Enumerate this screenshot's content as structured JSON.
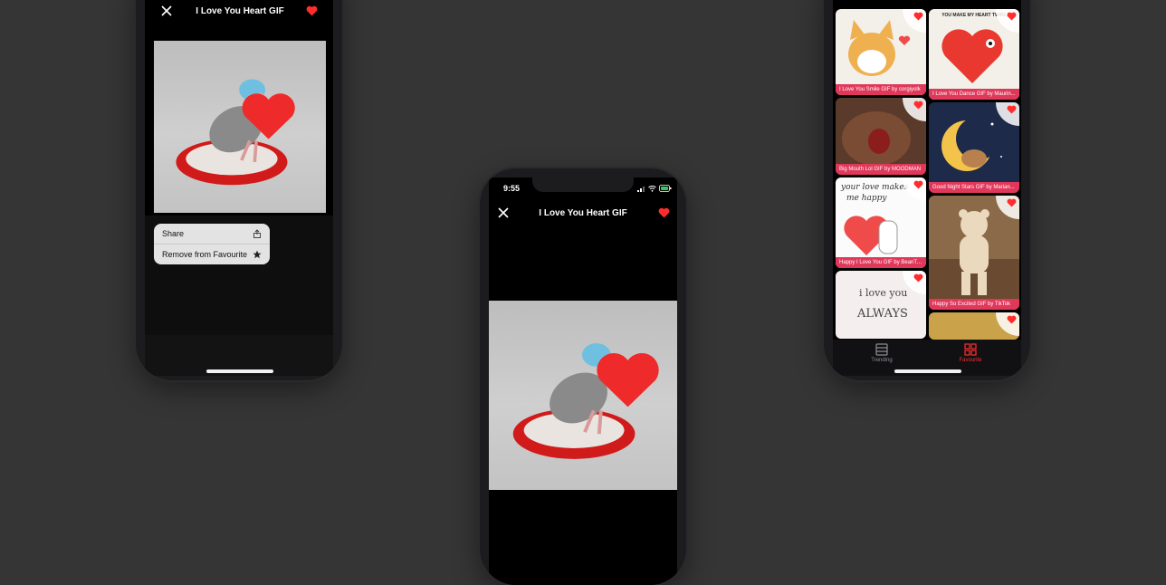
{
  "colors": {
    "accent": "#ff2d2d",
    "caption_bg": "#e0385a",
    "background": "#353535"
  },
  "left_phone": {
    "title": "I Love You Heart GIF",
    "menu": [
      {
        "label": "Share",
        "icon": "share-icon"
      },
      {
        "label": "Remove from Favourite",
        "icon": "star-icon"
      }
    ]
  },
  "center_phone": {
    "status_time": "9:55",
    "title": "I Love You Heart GIF"
  },
  "right_phone": {
    "cards": [
      {
        "caption": "I Love You Smile GIF by corgiyolk"
      },
      {
        "caption": "I Love You Dance GIF by Maurin..."
      },
      {
        "caption": "Big Mouth Lol GIF by MOODMAN"
      },
      {
        "caption": "Good Night Stars GIF by Marian..."
      },
      {
        "caption": "Happy I Love You GIF by BeanTo..."
      },
      {
        "caption": "Happy So Excited GIF by TikTok"
      },
      {
        "caption": ""
      },
      {
        "caption": ""
      }
    ],
    "card_texts": {
      "heart_banner": "YOU MAKE MY HEART TWIRL",
      "love_line1": "your love makes",
      "love_line2": "me happy",
      "always1": "i love you",
      "always2": "ALWAYS"
    },
    "tabs": [
      {
        "label": "Trending",
        "icon": "list-icon",
        "active": false
      },
      {
        "label": "Favourite",
        "icon": "grid-icon",
        "active": true
      }
    ]
  }
}
